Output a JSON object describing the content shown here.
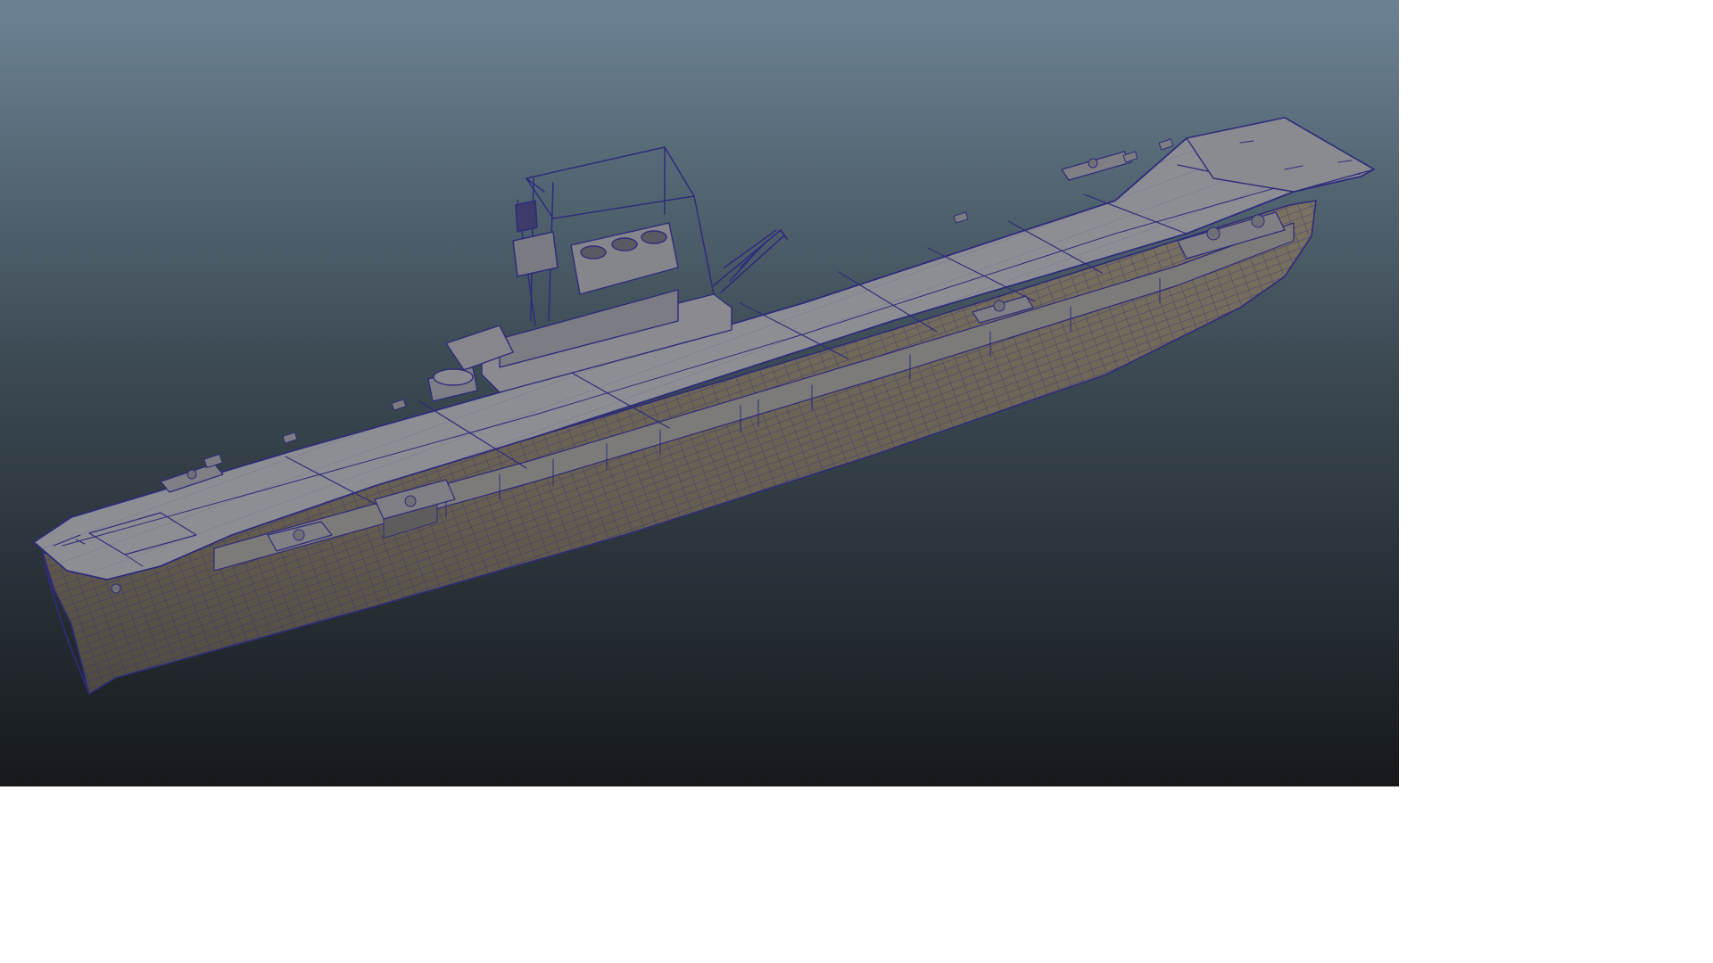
{
  "viewport": {
    "background_top": "#6c8293",
    "background_mid": "#3d4b55",
    "background_bottom": "#16191c"
  },
  "model": {
    "object": "aircraft-carrier",
    "display_mode": "wireframe-on-shaded",
    "wire_color": "#2e2c7a",
    "deck_color": "#8c8d92",
    "hull_color": "#6e6657",
    "hull_shadow_color": "#4f4a42",
    "superstructure_color": "#8a8a90"
  }
}
